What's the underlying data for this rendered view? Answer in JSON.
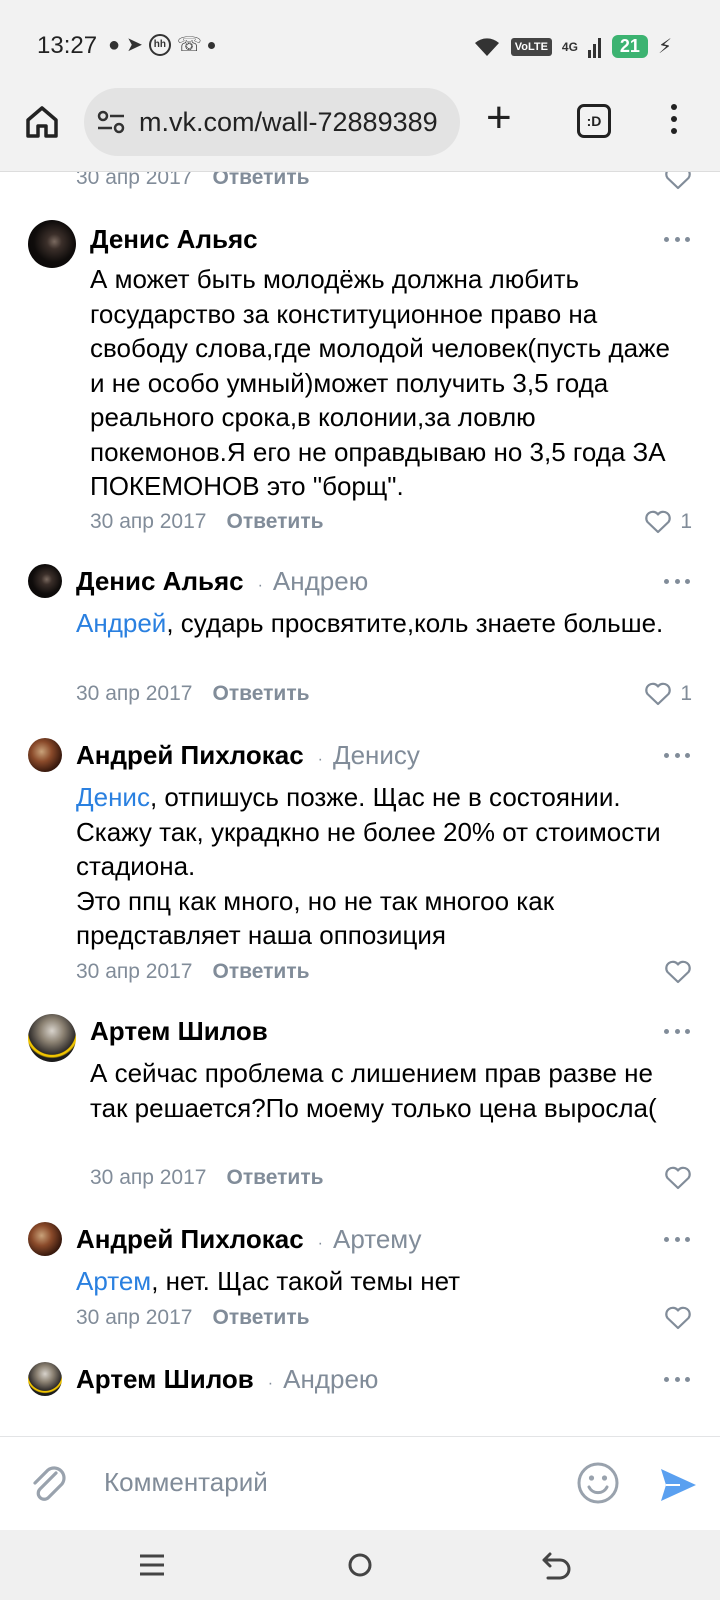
{
  "status_bar": {
    "time": "13:27",
    "network": "4G",
    "volte": "VoLTE",
    "battery": "21"
  },
  "browser": {
    "url": "m.vk.com/wall-72889389",
    "tabs_label": ":D"
  },
  "feed": {
    "top_item": {
      "date": "30 апр 2017",
      "reply_label": "Ответить"
    },
    "comments": [
      {
        "author": "Денис Альяс",
        "reply_to": "",
        "mention": "",
        "text": "А может быть молодёжь должна любить государство за конституционное право на свободу слова,где молодой человек(пусть даже и не особо умный)может получить 3,5 года реального срока,в колонии,за ловлю покемонов.Я его не оправдываю но 3,5 года ЗА ПОКЕМОНОВ это \"борщ\".",
        "date": "30 апр 2017",
        "reply_label": "Ответить",
        "likes": "1"
      },
      {
        "author": "Денис Альяс",
        "reply_to": "Андрею",
        "mention": "Андрей",
        "text": ", сударь просвятите,коль знаете больше.",
        "date": "30 апр 2017",
        "reply_label": "Ответить",
        "likes": "1"
      },
      {
        "author": "Андрей Пихлокас",
        "reply_to": "Денису",
        "mention": "Денис",
        "text": ", отпишусь позже. Щас не в состоянии. Скажу так, украдкно не более 20% от стоимости стадиона.\nЭто ппц как много, но не так многоо как представляет наша оппозиция",
        "date": "30 апр 2017",
        "reply_label": "Ответить",
        "likes": ""
      },
      {
        "author": "Артем Шилов",
        "reply_to": "",
        "mention": "",
        "text": "А сейчас проблема с лишением прав разве не так решается?По моему только цена выросла(",
        "date": "30 апр 2017",
        "reply_label": "Ответить",
        "likes": ""
      },
      {
        "author": "Андрей Пихлокас",
        "reply_to": "Артему",
        "mention": "Артем",
        "text": ", нет. Щас такой темы нет",
        "date": "30 апр 2017",
        "reply_label": "Ответить",
        "likes": ""
      },
      {
        "author": "Артем Шилов",
        "reply_to": "Андрею",
        "mention": "",
        "text": "",
        "date": "",
        "reply_label": "",
        "likes": ""
      }
    ]
  },
  "composer": {
    "placeholder": "Комментарий"
  },
  "colors": {
    "link": "#2a80e0",
    "meta": "#818c99",
    "send": "#5aa0f0"
  }
}
